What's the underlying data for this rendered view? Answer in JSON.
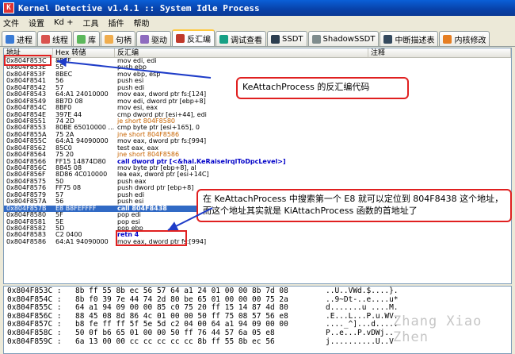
{
  "window": {
    "title": "Kernel Detective v1.4.1 :: System Idle Process"
  },
  "menu": [
    "文件",
    "设置",
    "Kd +",
    "工具",
    "插件",
    "帮助"
  ],
  "tabs": [
    {
      "label": "进程",
      "color": "#3a7bd5",
      "active": false
    },
    {
      "label": "线程",
      "color": "#d9534f",
      "active": false
    },
    {
      "label": "库",
      "color": "#5cb85c",
      "active": false
    },
    {
      "label": "句柄",
      "color": "#f0ad4e",
      "active": false
    },
    {
      "label": "驱动",
      "color": "#8e6bbf",
      "active": false
    },
    {
      "label": "反汇编",
      "color": "#c0392b",
      "active": true
    },
    {
      "label": "调试查看",
      "color": "#16a085",
      "active": false
    },
    {
      "label": "SSDT",
      "color": "#2c3e50",
      "active": false
    },
    {
      "label": "ShadowSSDT",
      "color": "#7f8c8d",
      "active": false
    },
    {
      "label": "中断描述表",
      "color": "#34495e",
      "active": false
    },
    {
      "label": "内核修改",
      "color": "#e67e22",
      "active": false
    }
  ],
  "grid": {
    "headers": [
      "地址",
      "Hex 转储",
      "反汇编",
      "注释"
    ],
    "rows": [
      [
        "0x804F853C",
        "8BFF",
        "mov edi, edi",
        ""
      ],
      [
        "0x804F853E",
        "55",
        "push ebp",
        ""
      ],
      [
        "0x804F853F",
        "8BEC",
        "mov ebp, esp",
        ""
      ],
      [
        "0x804F8541",
        "56",
        "push esi",
        ""
      ],
      [
        "0x804F8542",
        "57",
        "push edi",
        ""
      ],
      [
        "0x804F8543",
        "64:A1 24010000",
        "mov eax, dword ptr fs:[124]",
        ""
      ],
      [
        "0x804F8549",
        "8B7D 08",
        "mov edi, dword ptr [ebp+8]",
        ""
      ],
      [
        "0x804F854C",
        "8BF0",
        "mov esi, eax",
        ""
      ],
      [
        "0x804F854E",
        "397E 44",
        "cmp dword ptr [esi+44], edi",
        ""
      ],
      [
        "0x804F8551",
        "74 2D",
        "je short 804F8580",
        "",
        "orange"
      ],
      [
        "0x804F8553",
        "80BE 65010000 ...",
        "cmp byte ptr [esi+165], 0",
        ""
      ],
      [
        "0x804F855A",
        "75 2A",
        "jne short 804F8586",
        "",
        "orange"
      ],
      [
        "0x804F855C",
        "64:A1 94090000",
        "mov eax, dword ptr fs:[994]",
        ""
      ],
      [
        "0x804F8562",
        "85C0",
        "test eax, eax",
        ""
      ],
      [
        "0x804F8564",
        "75 20",
        "jne short 804F8586",
        "",
        "orange"
      ],
      [
        "0x804F8566",
        "FF15 14874D80",
        "call dword ptr [<&hal.KeRaiseIrqlToDpcLevel>]",
        "",
        "blue"
      ],
      [
        "0x804F856C",
        "8845 08",
        "mov byte ptr [ebp+8], al",
        ""
      ],
      [
        "0x804F856F",
        "8D86 4C010000",
        "lea eax, dword ptr [esi+14C]",
        ""
      ],
      [
        "0x804F8575",
        "50",
        "push eax",
        ""
      ],
      [
        "0x804F8576",
        "FF75 08",
        "push dword ptr [ebp+8]",
        ""
      ],
      [
        "0x804F8579",
        "57",
        "push edi",
        ""
      ],
      [
        "0x804F857A",
        "56",
        "push esi",
        ""
      ],
      [
        "0x804F857B",
        "E8 B8FEFFFF",
        "call 804F8438",
        "",
        "sel"
      ],
      [
        "0x804F8580",
        "5F",
        "pop edi",
        ""
      ],
      [
        "0x804F8581",
        "5E",
        "pop esi",
        ""
      ],
      [
        "0x804F8582",
        "5D",
        "pop ebp",
        ""
      ],
      [
        "0x804F8583",
        "C2 0400",
        "retn 4",
        "",
        "blue"
      ],
      [
        "0x804F8586",
        "64:A1 94090000",
        "mov eax, dword ptr fs:[994]",
        ""
      ]
    ]
  },
  "hexdump": [
    [
      "0x804F853C :",
      "8b ff 55 8b ec 56 57 64 a1 24 01 00 00 8b 7d 08",
      "..U..VWd.$....}."
    ],
    [
      "0x804F854C :",
      "8b f0 39 7e 44 74 2d 80 be 65 01 00 00 00 75 2a",
      "..9~Dt-..e....u*"
    ],
    [
      "0x804F855C :",
      "64 a1 94 09 00 00 85 c0 75 20 ff 15 14 87 4d 80",
      "d.......u ....M."
    ],
    [
      "0x804F856C :",
      "88 45 08 8d 86 4c 01 00 00 50 ff 75 08 57 56 e8",
      ".E...L...P.u.WV."
    ],
    [
      "0x804F857C :",
      "b8 fe ff ff 5f 5e 5d c2 04 00 64 a1 94 09 00 00",
      "...._^]...d....."
    ],
    [
      "0x804F858C :",
      "50 0f b6 65 01 00 00 50 ff 76 44 57 6a 05 e8",
      "P..e...P.vDWj.."
    ],
    [
      "0x804F859C :",
      "6a 13 00 00 cc cc cc cc cc 8b ff 55 8b ec 56",
      "j..........U..V"
    ]
  ],
  "annotations": {
    "callout1": "KeAttachProcess 的反汇编代码",
    "callout2": "在 KeAttachProcess 中搜索第一个 E8 就可以定位到 804F8438 这个地址，而这个地址其实就是 KiAttachProcess 函数的首地址了"
  },
  "watermark": "Zhang Xiao Zhen"
}
